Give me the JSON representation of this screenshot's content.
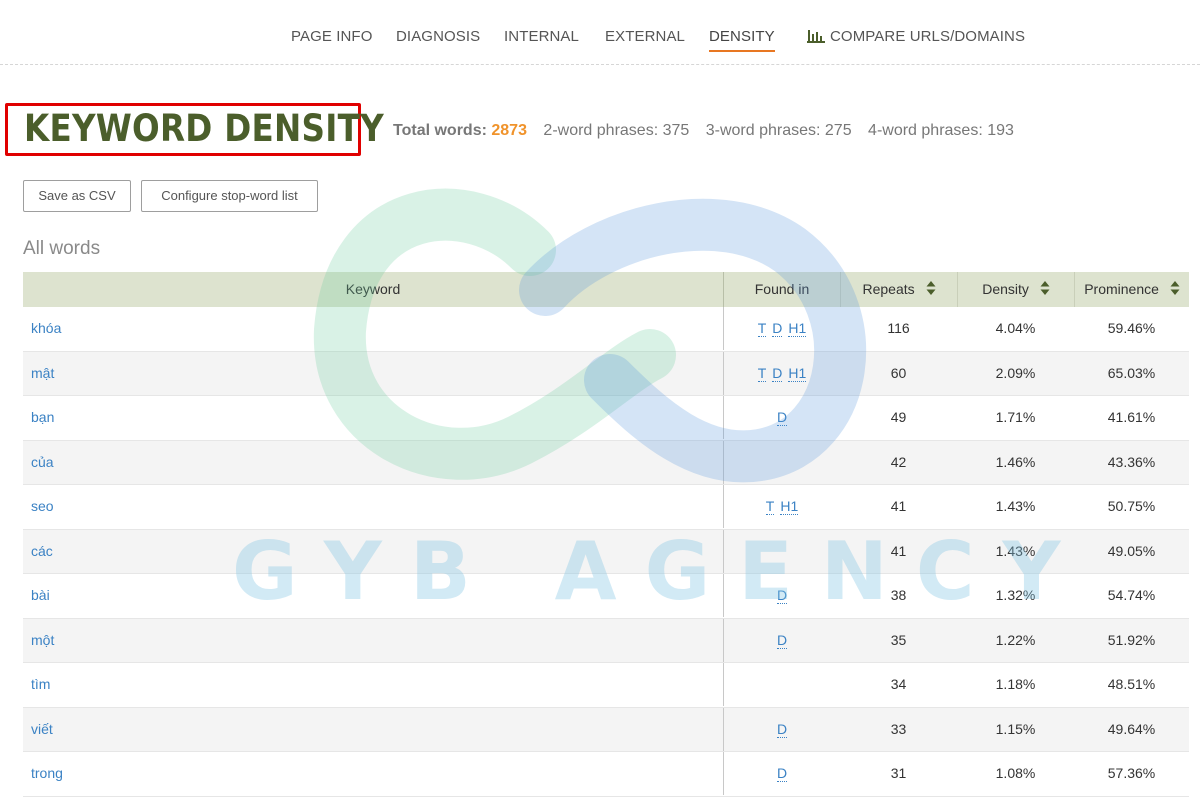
{
  "nav": {
    "items": [
      {
        "label": "PAGE INFO",
        "active": false
      },
      {
        "label": "DIAGNOSIS",
        "active": false
      },
      {
        "label": "INTERNAL",
        "active": false
      },
      {
        "label": "EXTERNAL",
        "active": false
      },
      {
        "label": "DENSITY",
        "active": true
      },
      {
        "label": "COMPARE URLS/DOMAINS",
        "active": false,
        "icon": "bar-chart-icon"
      }
    ],
    "active_color": "#e87722"
  },
  "header": {
    "title": "KEYWORD DENSITY",
    "total_words_label": "Total words:",
    "total_words_value": "2873",
    "two_word": "2-word phrases: 375",
    "three_word": "3-word phrases: 275",
    "four_word": "4-word phrases: 193"
  },
  "buttons": {
    "save_csv": "Save as CSV",
    "configure": "Configure stop-word list"
  },
  "section": {
    "title": "All words"
  },
  "table": {
    "columns": {
      "keyword": "Keyword",
      "found_in": "Found in",
      "repeats": "Repeats",
      "density": "Density",
      "prominence": "Prominence"
    },
    "rows": [
      {
        "keyword": "khóa",
        "found": [
          "T",
          "D",
          "H1"
        ],
        "repeats": "116",
        "density": "4.04%",
        "prominence": "59.46%"
      },
      {
        "keyword": "mật",
        "found": [
          "T",
          "D",
          "H1"
        ],
        "repeats": "60",
        "density": "2.09%",
        "prominence": "65.03%"
      },
      {
        "keyword": "bạn",
        "found": [
          "D"
        ],
        "repeats": "49",
        "density": "1.71%",
        "prominence": "41.61%"
      },
      {
        "keyword": "của",
        "found": [],
        "repeats": "42",
        "density": "1.46%",
        "prominence": "43.36%"
      },
      {
        "keyword": "seo",
        "found": [
          "T",
          "H1"
        ],
        "repeats": "41",
        "density": "1.43%",
        "prominence": "50.75%"
      },
      {
        "keyword": "các",
        "found": [],
        "repeats": "41",
        "density": "1.43%",
        "prominence": "49.05%"
      },
      {
        "keyword": "bài",
        "found": [
          "D"
        ],
        "repeats": "38",
        "density": "1.32%",
        "prominence": "54.74%"
      },
      {
        "keyword": "một",
        "found": [
          "D"
        ],
        "repeats": "35",
        "density": "1.22%",
        "prominence": "51.92%"
      },
      {
        "keyword": "tìm",
        "found": [],
        "repeats": "34",
        "density": "1.18%",
        "prominence": "48.51%"
      },
      {
        "keyword": "viết",
        "found": [
          "D"
        ],
        "repeats": "33",
        "density": "1.15%",
        "prominence": "49.64%"
      },
      {
        "keyword": "trong",
        "found": [
          "D"
        ],
        "repeats": "31",
        "density": "1.08%",
        "prominence": "57.36%"
      }
    ]
  },
  "watermark": {
    "text": "GYB AGENCY"
  },
  "colors": {
    "title": "#4b5e2b",
    "total_words_value": "#f0932b",
    "link": "#3b82c4",
    "table_header_bg": "#dde3cf",
    "highlight_box": "#e00000"
  }
}
